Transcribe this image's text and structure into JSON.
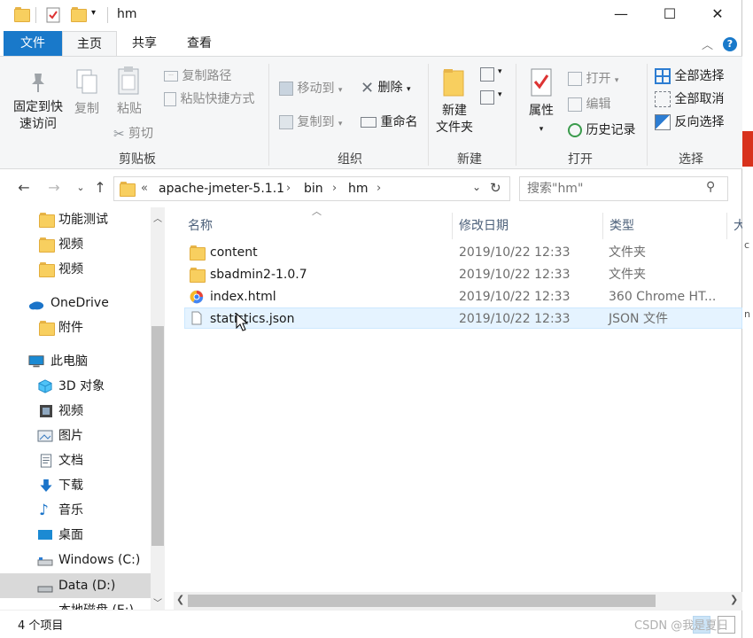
{
  "window": {
    "title": "hm"
  },
  "window_controls": {
    "minimize": "—",
    "maximize": "☐",
    "close": "✕"
  },
  "tabs": {
    "file": "文件",
    "home": "主页",
    "share": "共享",
    "view": "查看"
  },
  "ribbon": {
    "clipboard": {
      "pin_line1": "固定到快",
      "pin_line2": "速访问",
      "copy": "复制",
      "paste": "粘贴",
      "copy_path": "复制路径",
      "paste_shortcut": "粘贴快捷方式",
      "cut": "剪切",
      "label": "剪贴板"
    },
    "organize": {
      "move_to": "移动到",
      "copy_to": "复制到",
      "delete": "删除",
      "rename": "重命名",
      "label": "组织"
    },
    "new": {
      "new_folder_line1": "新建",
      "new_folder_line2": "文件夹",
      "label": "新建"
    },
    "open": {
      "properties": "属性",
      "open": "打开",
      "edit": "编辑",
      "history": "历史记录",
      "label": "打开"
    },
    "select": {
      "select_all": "全部选择",
      "select_none": "全部取消",
      "invert": "反向选择",
      "label": "选择"
    }
  },
  "address": {
    "overflow": "«",
    "crumbs": [
      "apache-jmeter-5.1.1",
      "bin",
      "hm"
    ],
    "separator": "›"
  },
  "search": {
    "placeholder": "搜索\"hm\""
  },
  "nav": {
    "items": [
      {
        "label": "功能测试",
        "icon": "folder-icon"
      },
      {
        "label": "视频",
        "icon": "folder-icon"
      },
      {
        "label": "视频",
        "icon": "folder-icon"
      },
      {
        "label": "OneDrive",
        "icon": "onedrive-icon"
      },
      {
        "label": "附件",
        "icon": "folder-icon"
      },
      {
        "label": "此电脑",
        "icon": "computer-icon"
      },
      {
        "label": "3D 对象",
        "icon": "3d-objects-icon"
      },
      {
        "label": "视频",
        "icon": "video-icon"
      },
      {
        "label": "图片",
        "icon": "pictures-icon"
      },
      {
        "label": "文档",
        "icon": "documents-icon"
      },
      {
        "label": "下载",
        "icon": "downloads-icon"
      },
      {
        "label": "音乐",
        "icon": "music-icon"
      },
      {
        "label": "桌面",
        "icon": "desktop-icon"
      },
      {
        "label": "Windows (C:)",
        "icon": "drive-icon"
      },
      {
        "label": "Data (D:)",
        "icon": "drive-icon"
      },
      {
        "label": "本地磁盘 (E:)",
        "icon": "drive-icon"
      }
    ]
  },
  "columns": {
    "name": "名称",
    "modified": "修改日期",
    "type": "类型",
    "size": "大"
  },
  "files": [
    {
      "name": "content",
      "modified": "2019/10/22 12:33",
      "type": "文件夹",
      "icon": "folder-icon"
    },
    {
      "name": "sbadmin2-1.0.7",
      "modified": "2019/10/22 12:33",
      "type": "文件夹",
      "icon": "folder-icon"
    },
    {
      "name": "index.html",
      "modified": "2019/10/22 12:33",
      "type": "360 Chrome HT...",
      "icon": "html-file-icon"
    },
    {
      "name": "statistics.json",
      "modified": "2019/10/22 12:33",
      "type": "JSON 文件",
      "icon": "json-file-icon"
    }
  ],
  "status": {
    "item_count": "4 个项目"
  },
  "watermark": "CSDN @我是夏日",
  "colors": {
    "accent": "#1979ca",
    "folder": "#f8cf5f",
    "selected": "#e5f3ff"
  }
}
